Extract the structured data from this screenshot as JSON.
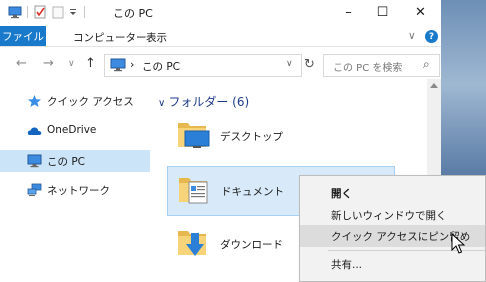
{
  "titlebar": {
    "title": "この PC",
    "minimize_glyph": "–",
    "maximize_glyph": "☐",
    "close_glyph": "✕",
    "quick_access_icons": [
      "computer-icon",
      "properties-check-icon",
      "new-folder-icon",
      "customize-dropdown-icon"
    ]
  },
  "ribbon": {
    "file_tab": "ファイル",
    "tabs": [
      "コンピューター",
      "表示"
    ],
    "expand_glyph": "∨",
    "help_glyph": "?"
  },
  "address": {
    "back_glyph": "←",
    "forward_glyph": "→",
    "recent_glyph": "∨",
    "up_glyph": "↑",
    "separator": "›",
    "path": "この PC",
    "dropdown_glyph": "∨",
    "refresh_glyph": "↻",
    "search_placeholder": "この PC を検索",
    "search_glyph": "⌕"
  },
  "navpane": {
    "items": [
      {
        "label": "クイック アクセス",
        "icon": "star-icon"
      },
      {
        "label": "OneDrive",
        "icon": "cloud-icon"
      },
      {
        "label": "この PC",
        "icon": "computer-icon",
        "selected": true
      },
      {
        "label": "ネットワーク",
        "icon": "network-icon"
      }
    ]
  },
  "content": {
    "group_chevron": "∨",
    "group_header": "フォルダー (6)",
    "folders": [
      {
        "label": "デスクトップ",
        "icon": "desktop-folder-icon"
      },
      {
        "label": "ドキュメント",
        "icon": "documents-folder-icon",
        "hover": true
      },
      {
        "label": "ダウンロード",
        "icon": "downloads-folder-icon"
      }
    ]
  },
  "context_menu": {
    "items": [
      {
        "label": "開く",
        "bold": true
      },
      {
        "label": "新しいウィンドウで開く"
      },
      {
        "label": "クイック アクセスにピン留め",
        "highlighted": true
      },
      {
        "label": "共有..."
      }
    ]
  },
  "colors": {
    "accent": "#1979ca",
    "selected_nav": "#cce4f7",
    "hover_item": "#d8eaf9",
    "group_header": "#1e3c8c",
    "menu_bg": "#f2f2f2"
  }
}
